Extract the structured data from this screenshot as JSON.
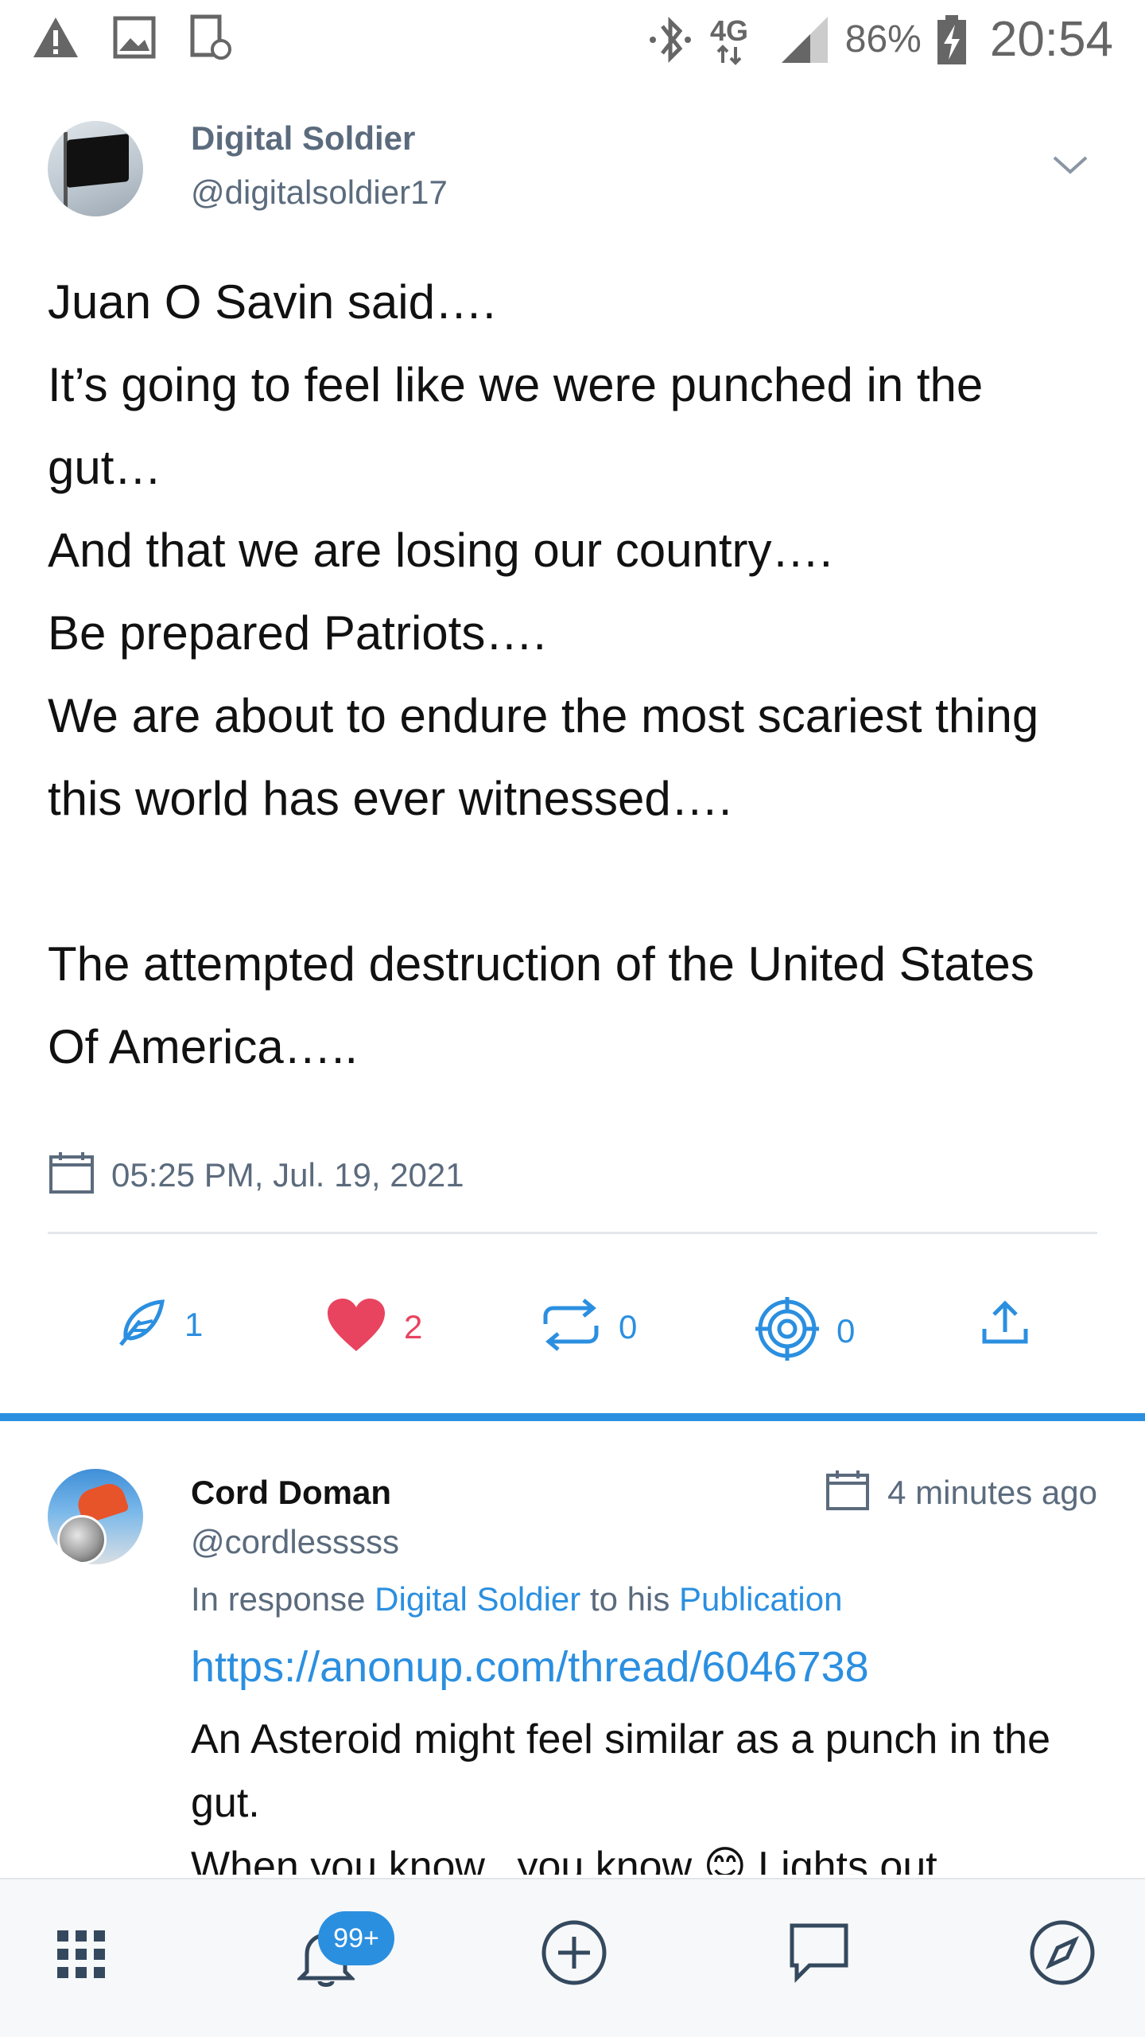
{
  "status_bar": {
    "battery": "86%",
    "time": "20:54",
    "network": "4G"
  },
  "post": {
    "author_name": "Digital Soldier",
    "author_handle": "@digitalsoldier17",
    "body": "Juan O Savin said….\nIt’s going to feel like we were punched in the gut…\nAnd that we are losing our country….\nBe prepared Patriots….\nWe are about to endure the most scariest thing this world has ever witnessed….\n\nThe attempted destruction of the United States Of America…..",
    "date": "05:25 PM, Jul. 19, 2021",
    "actions": {
      "replies": "1",
      "likes": "2",
      "reposts": "0",
      "targets": "0"
    }
  },
  "reply": {
    "author_name": "Cord Doman",
    "author_handle": "@cordlesssss",
    "time": "4 minutes ago",
    "context_prefix": "In response",
    "context_user": "Digital Soldier",
    "context_mid": "to his",
    "context_target": "Publication",
    "link": "https://anonup.com/thread/6046738",
    "text_line1": "An Asteroid might feel similar as a punch in the gut.",
    "text_line2": "When you know...you know 😊 Lights out"
  },
  "bottom_nav": {
    "badge": "99+"
  },
  "colors": {
    "accent": "#2b8fe0",
    "like": "#e8445f",
    "muted": "#5b6b7d"
  }
}
